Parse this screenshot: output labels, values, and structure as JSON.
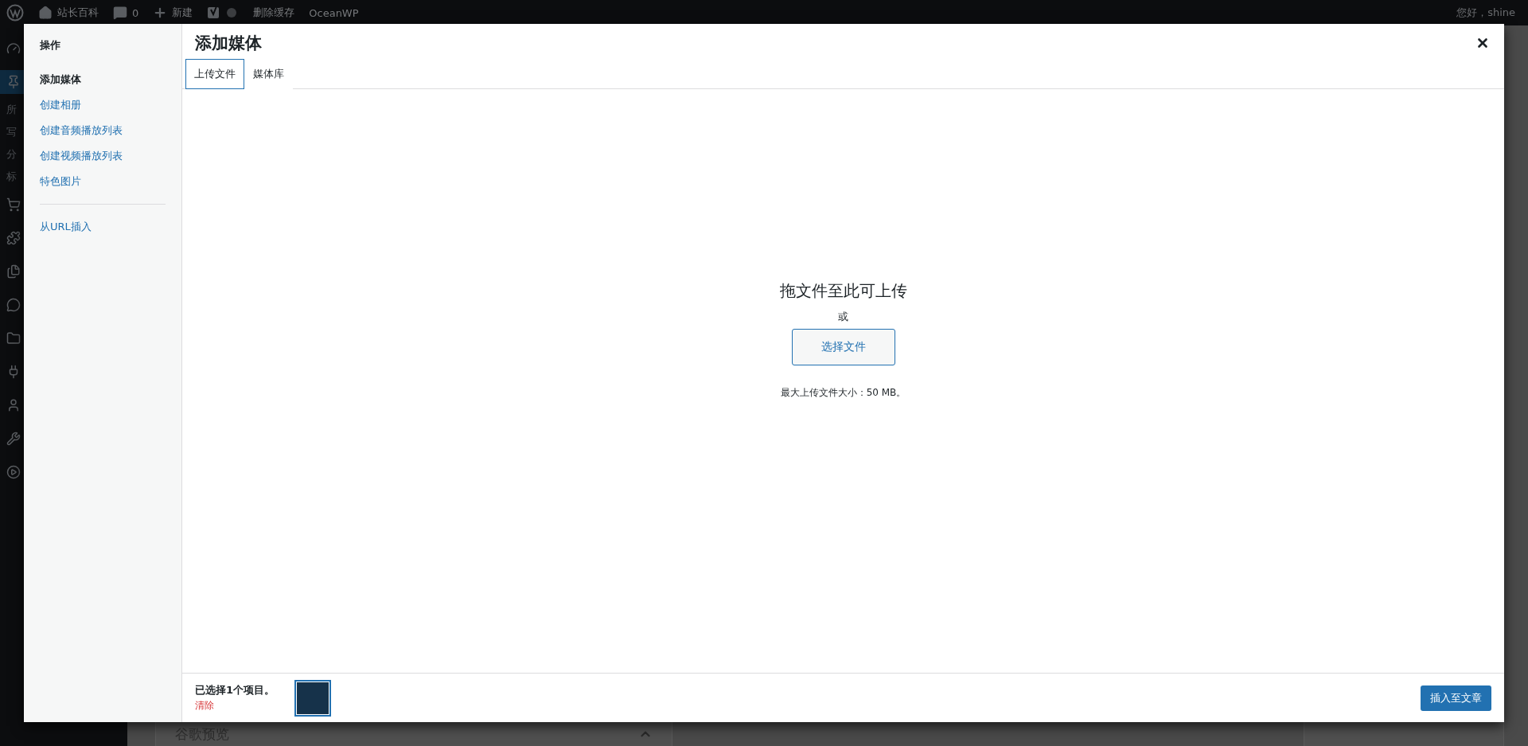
{
  "admin_bar": {
    "items": [
      {
        "kind": "logo"
      },
      {
        "kind": "site",
        "label": "站长百科"
      },
      {
        "kind": "comments",
        "label": "0"
      },
      {
        "kind": "new",
        "label": "新建"
      },
      {
        "kind": "yoast"
      },
      {
        "kind": "cache",
        "label": "删除缓存"
      },
      {
        "kind": "text",
        "label": "OceanWP"
      }
    ],
    "greeting": "您好，shine"
  },
  "background": {
    "sidebar_letters": [
      "所",
      "写",
      "分",
      "标"
    ],
    "panel_title": "谷歌预览"
  },
  "modal": {
    "title": "添加媒体",
    "sidebar": {
      "heading": "操作",
      "items": [
        {
          "label": "添加媒体",
          "selected": true
        },
        {
          "label": "创建相册",
          "selected": false
        },
        {
          "label": "创建音频播放列表",
          "selected": false
        },
        {
          "label": "创建视频播放列表",
          "selected": false
        },
        {
          "label": "特色图片",
          "selected": false
        }
      ],
      "extra": [
        {
          "label": "从URL插入",
          "selected": false
        }
      ]
    },
    "tabs": [
      {
        "label": "上传文件",
        "selected": true
      },
      {
        "label": "媒体库",
        "selected": false
      }
    ],
    "upload": {
      "instructions": "拖文件至此可上传",
      "or": "或",
      "button": "选择文件",
      "max_size": "最大上传文件大小：50 MB。"
    },
    "footer": {
      "selection_count": "已选择1个项目。",
      "clear": "清除",
      "insert_button": "插入至文章"
    }
  }
}
